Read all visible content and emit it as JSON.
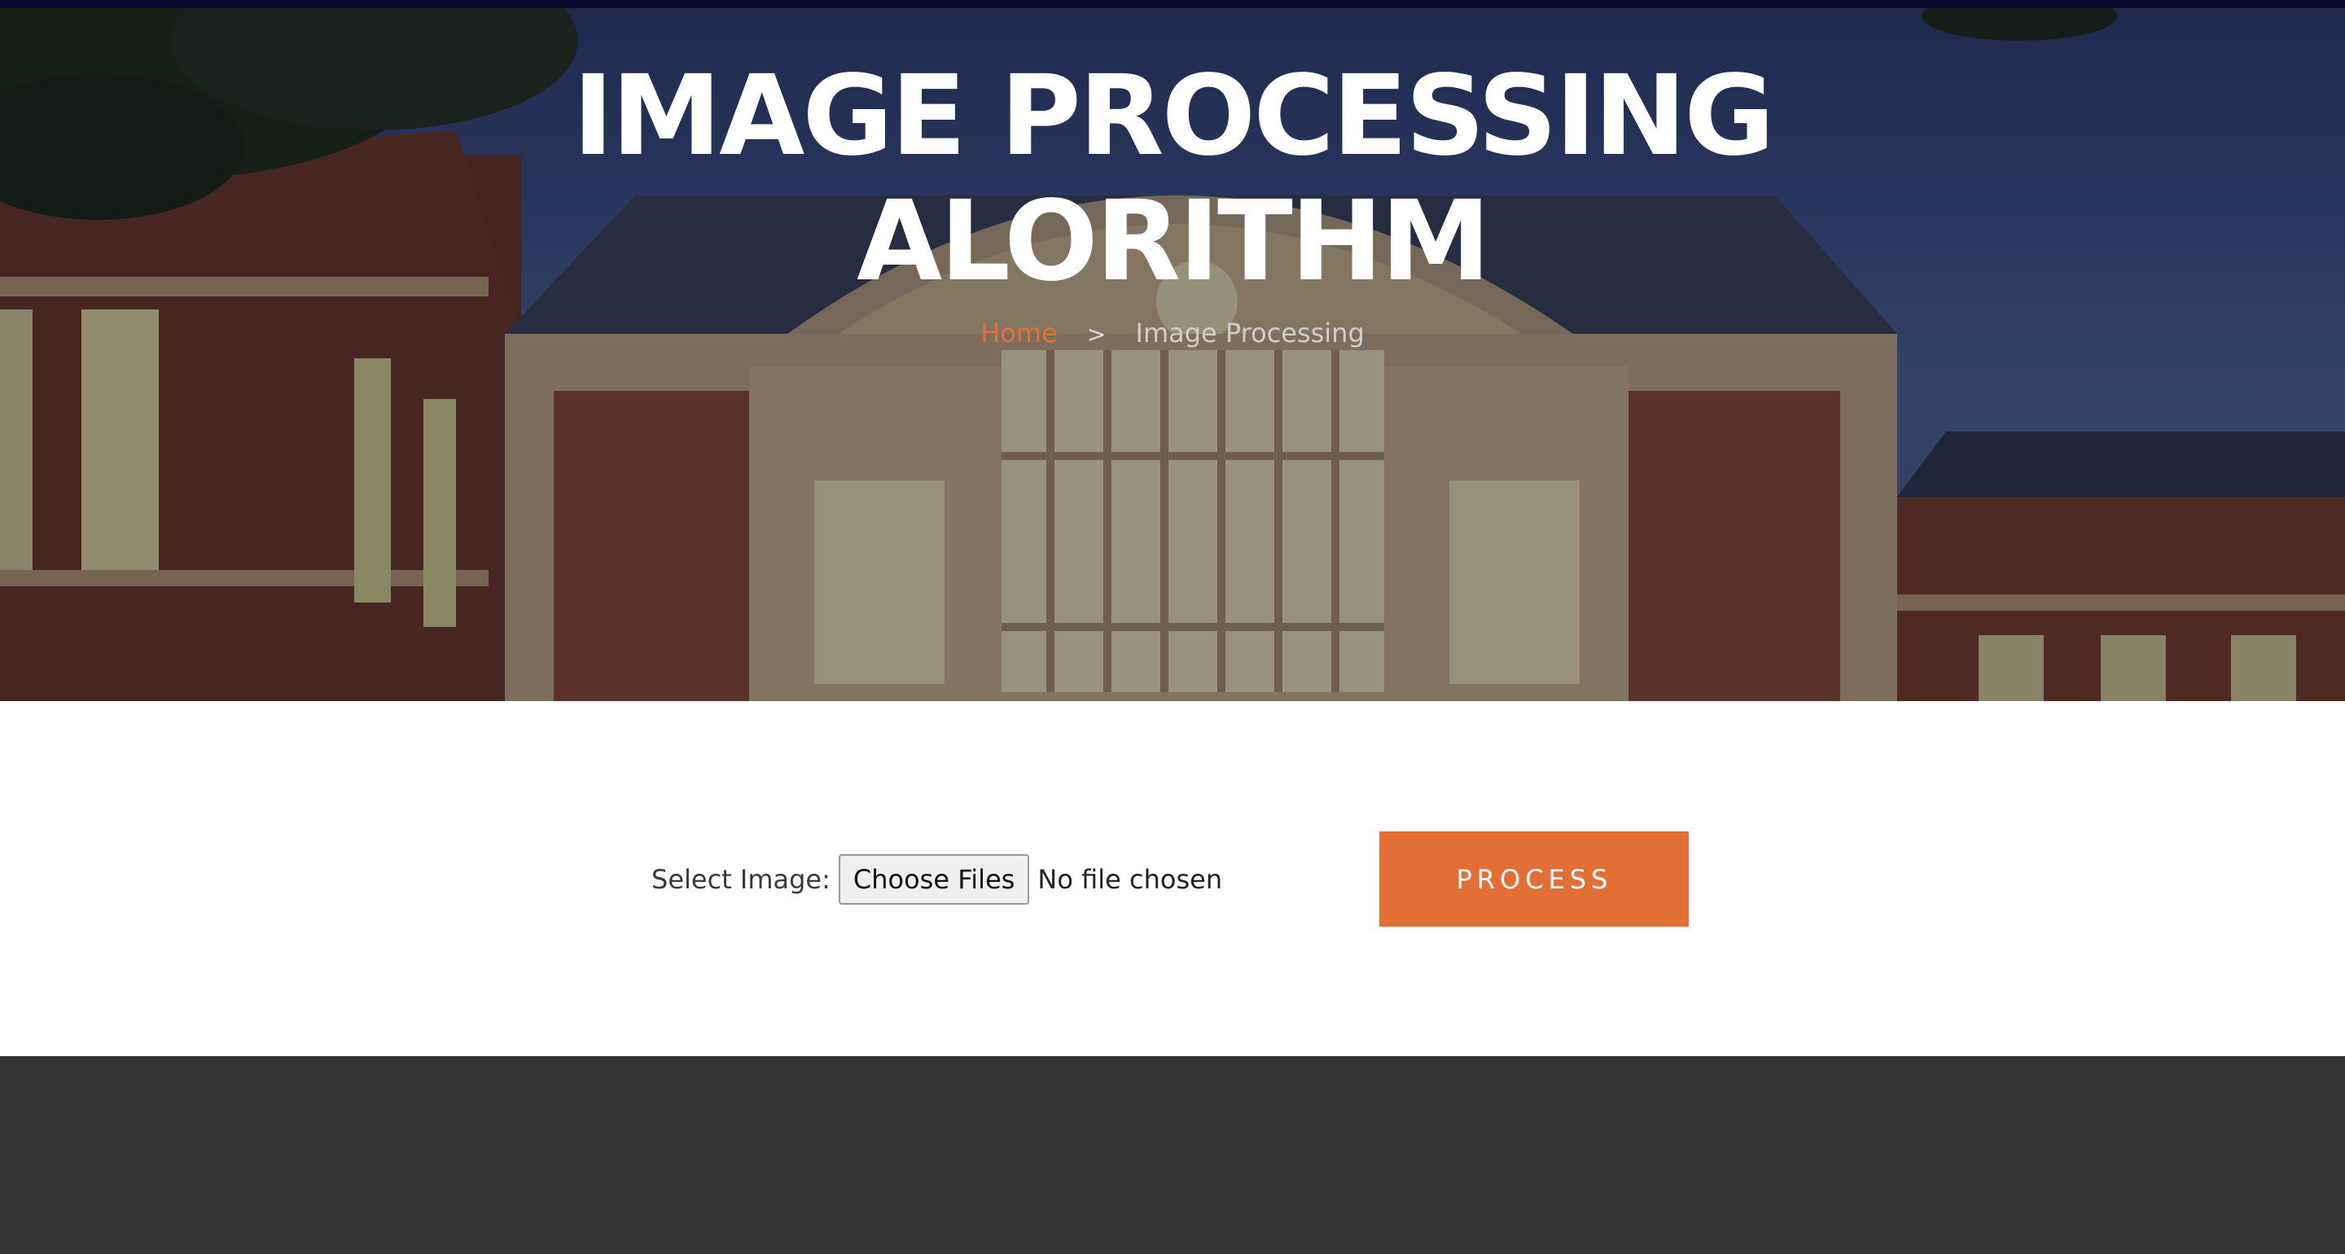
{
  "hero": {
    "title_line1": "IMAGE PROCESSING",
    "title_line2": "ALORITHM",
    "breadcrumb": {
      "home": "Home",
      "separator": ">",
      "current": "Image Processing"
    }
  },
  "upload": {
    "select_label": "Select Image:",
    "choose_button": "Choose Files",
    "file_status": "No file chosen",
    "process_button": "PROCESS"
  },
  "colors": {
    "accent": "#e27036",
    "footer": "#333333",
    "topbar": "#0a0a2e"
  }
}
